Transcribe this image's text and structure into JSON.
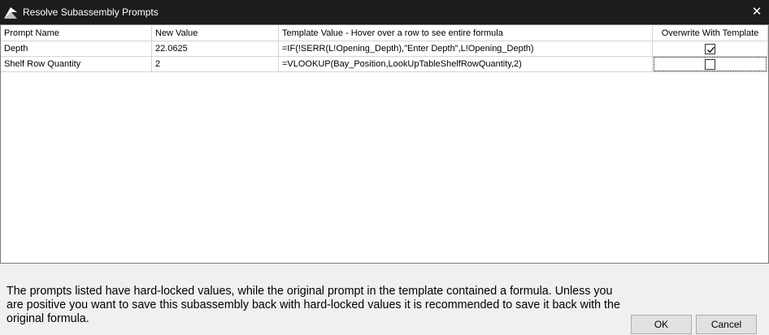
{
  "window": {
    "title": "Resolve Subassembly Prompts",
    "close_label": "✕"
  },
  "grid": {
    "columns": [
      "Prompt Name",
      "New Value",
      "Template Value - Hover over a row to see entire formula",
      "Overwrite With Template"
    ],
    "rows": [
      {
        "prompt_name": "Depth",
        "new_value": "22.0625",
        "template_value": "=IF(!SERR(L!Opening_Depth),\"Enter Depth\",L!Opening_Depth)",
        "overwrite": true
      },
      {
        "prompt_name": "Shelf Row Quantity",
        "new_value": "2",
        "template_value": "=VLOOKUP(Bay_Position,LookUpTableShelfRowQuantity,2)",
        "overwrite": false
      }
    ]
  },
  "message": "The prompts listed have hard-locked values, while the original prompt in the template contained a formula.  Unless you are positive you want to save this subassembly back with hard-locked values it is recommended to save it back with the original formula.",
  "buttons": {
    "ok": "OK",
    "cancel": "Cancel"
  }
}
